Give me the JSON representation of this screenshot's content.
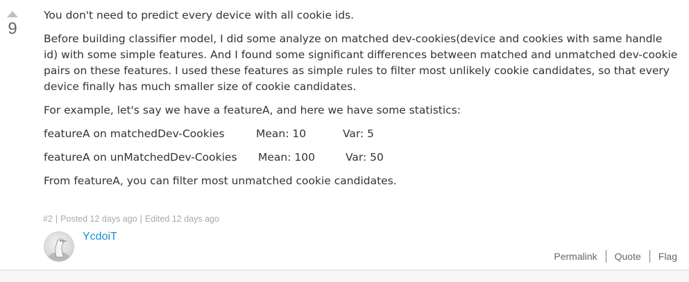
{
  "vote": {
    "count": "9",
    "upvote_icon": "triangle-up-icon"
  },
  "post": {
    "paragraphs": [
      "You don't need to predict every device with all cookie ids.",
      "Before building classifier model, I did some analyze on matched dev-cookies(device and cookies with same handle id) with some simple features. And I found some significant differences between matched and unmatched dev-cookie pairs on these features. I used these features as simple rules  to filter most unlikely cookie candidates, so that every device finally has much smaller size of cookie candidates.",
      "For example, let's say we have a featureA, and here we have some statistics:"
    ],
    "stats": [
      {
        "label": "featureA on matchedDev-Cookies",
        "mean": "Mean: 10",
        "var": "Var: 5"
      },
      {
        "label": "featureA on unMatchedDev-Cookies",
        "mean": "Mean: 100",
        "var": "Var: 50"
      }
    ],
    "closing": "From featureA, you can filter most unmatched cookie candidates."
  },
  "meta": {
    "number": "#2",
    "posted": "Posted 12 days ago",
    "edited": "Edited 12 days ago",
    "separator": "|"
  },
  "author": {
    "name": "YcdoiT",
    "avatar_icon": "goose-avatar"
  },
  "actions": {
    "permalink": "Permalink",
    "quote": "Quote",
    "flag": "Flag"
  },
  "colors": {
    "link": "#1a8fd1",
    "text": "#333333",
    "muted": "#a9a9a9"
  }
}
